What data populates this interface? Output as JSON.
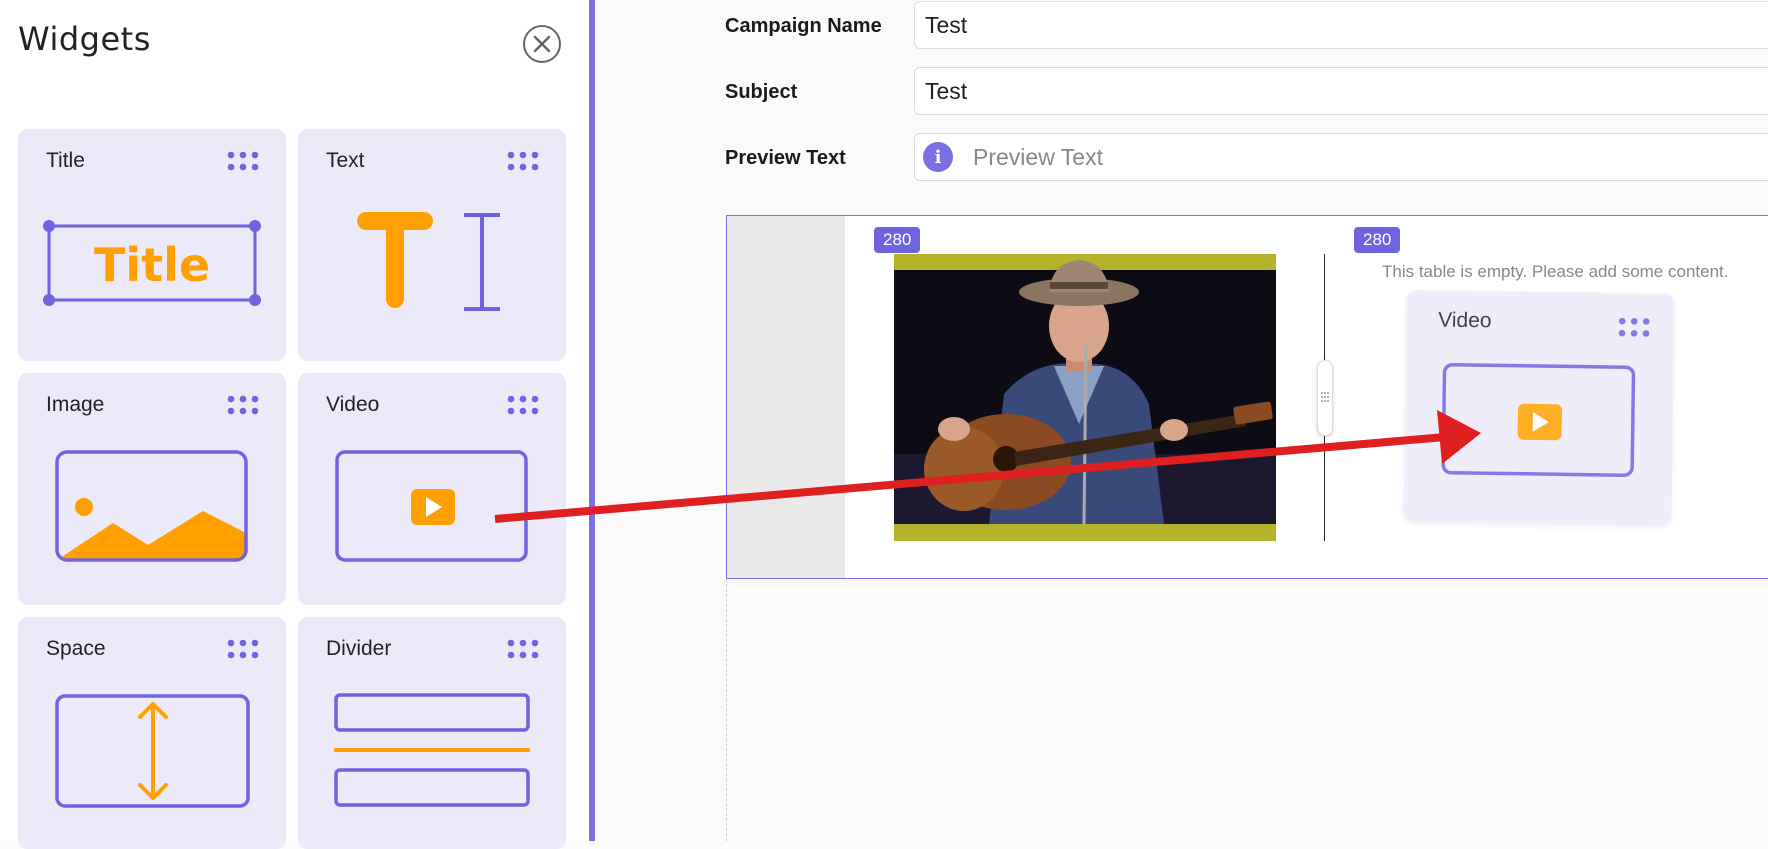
{
  "panel": {
    "title": "Widgets",
    "close_icon": "close-circle-icon"
  },
  "widgets": [
    {
      "label": "Title",
      "art_text": "Title",
      "icon": "title-widget-icon"
    },
    {
      "label": "Text",
      "icon": "text-widget-icon"
    },
    {
      "label": "Image",
      "icon": "image-widget-icon"
    },
    {
      "label": "Video",
      "icon": "video-widget-icon"
    },
    {
      "label": "Space",
      "icon": "space-widget-icon"
    },
    {
      "label": "Divider",
      "icon": "divider-widget-icon"
    }
  ],
  "form": {
    "campaign_name_label": "Campaign Name",
    "campaign_name_value": "Test",
    "subject_label": "Subject",
    "subject_value": "Test",
    "preview_text_label": "Preview Text",
    "preview_text_placeholder": "Preview Text"
  },
  "canvas": {
    "left_column_width": "280",
    "right_column_width": "280",
    "empty_message": "This table is empty. Please add some content.",
    "drag_ghost_label": "Video"
  },
  "colors": {
    "accent": "#7b6fe4",
    "orange": "#ffa000",
    "card_bg": "#eceaf9",
    "arrow": "#e02020"
  }
}
